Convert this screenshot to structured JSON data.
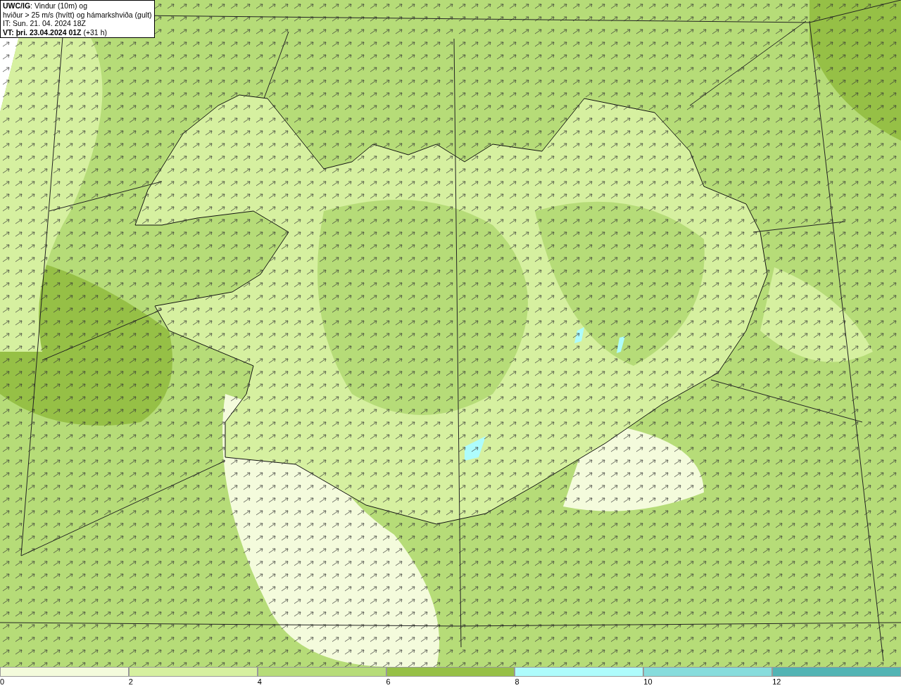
{
  "info_box": {
    "lines": [
      "**UWC/IG**: Vindur (10m) og",
      "hviður > 25 m/s (hvítt) og hámarkshviða (gult)",
      "IT: Sun. 21. 04. 2024 18Z",
      "**VT: þri. 23.04.2024 01Z** (+31 h)"
    ]
  },
  "legend": {
    "bins": [
      {
        "label": "0",
        "color": "#f4fbdc"
      },
      {
        "label": "2",
        "color": "#d6f0a0"
      },
      {
        "label": "4",
        "color": "#b6dc78"
      },
      {
        "label": "6",
        "color": "#96c046"
      },
      {
        "label": "8",
        "color": "#aefcfc"
      },
      {
        "label": "10",
        "color": "#86dcdc"
      },
      {
        "label": "12",
        "color": "#52b4b4"
      }
    ]
  }
}
